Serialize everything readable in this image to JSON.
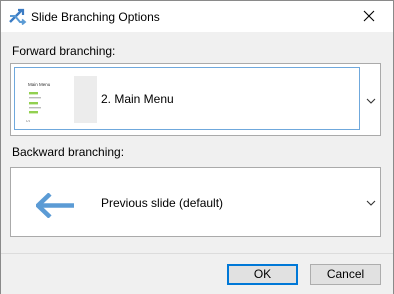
{
  "window": {
    "title": "Slide Branching Options",
    "icon": "branch-arrows-icon",
    "close_icon": "close-icon"
  },
  "forward": {
    "label": "Forward branching:",
    "selected_text": "2. Main Menu",
    "thumbnail": {
      "heading": "Main Menu",
      "footer": "1/1"
    }
  },
  "backward": {
    "label": "Backward branching:",
    "selected_text": "Previous slide (default)",
    "icon": "left-arrow-icon"
  },
  "buttons": {
    "ok": "OK",
    "cancel": "Cancel"
  },
  "colors": {
    "accent": "#0078d7",
    "arrow_blue": "#5b9bd5",
    "thumb_green": "#92d050"
  }
}
